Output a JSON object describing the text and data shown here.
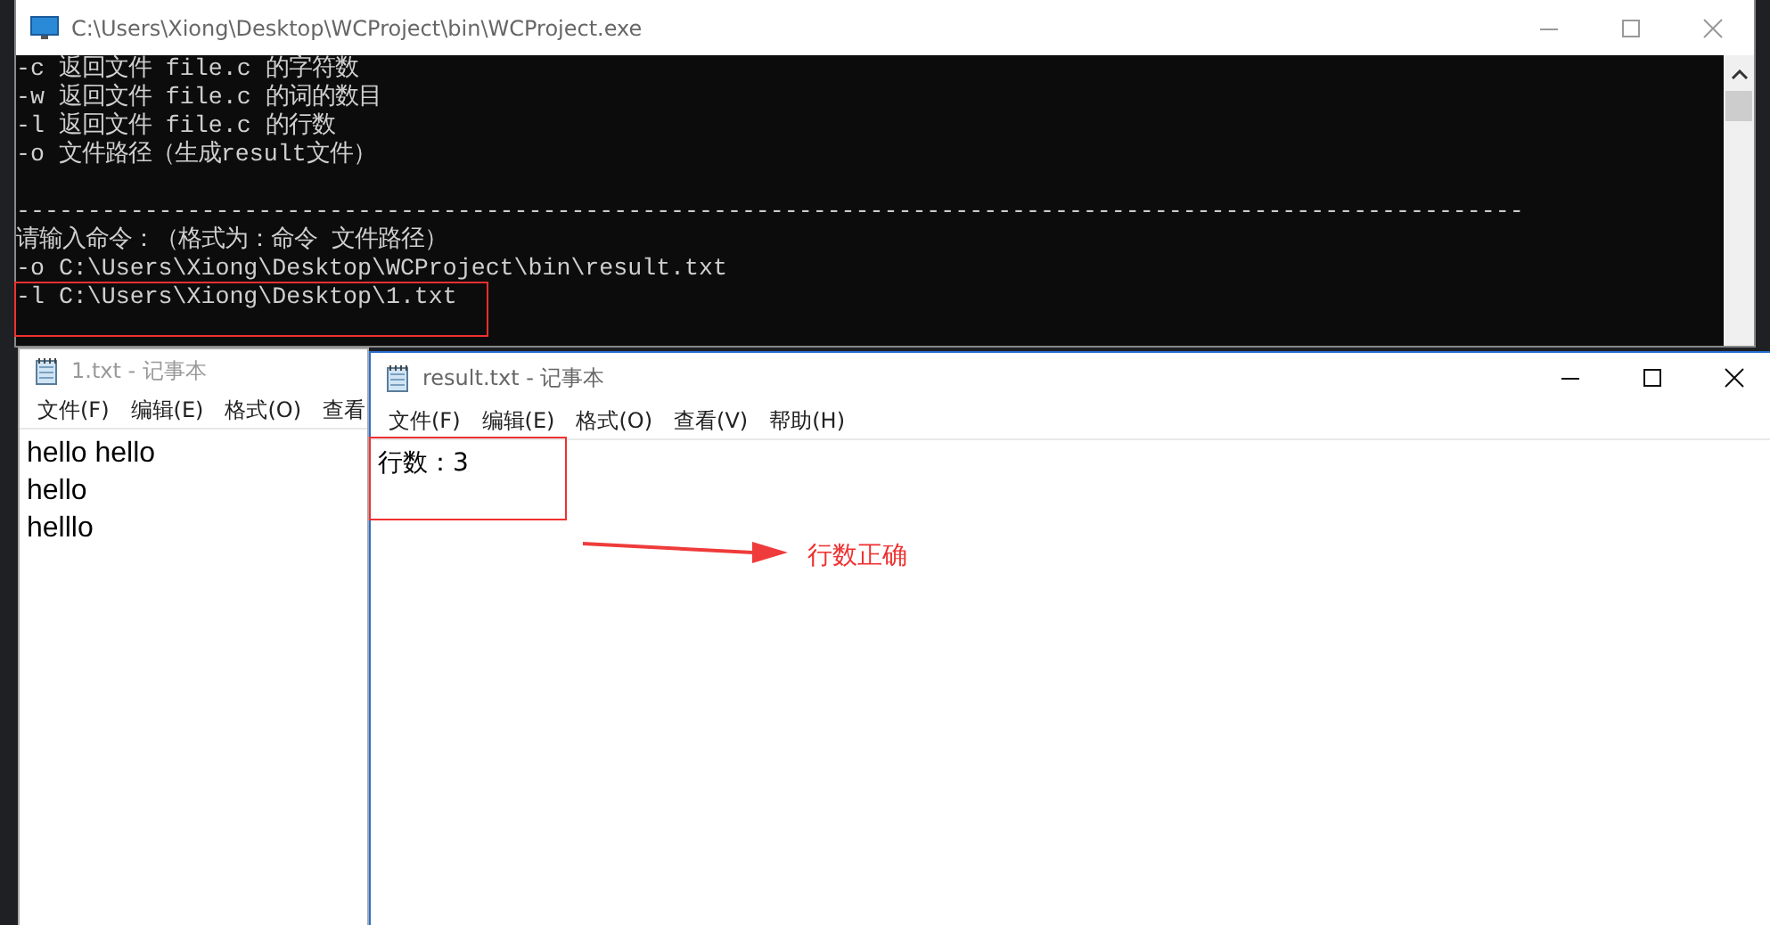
{
  "console": {
    "title": "C:\\Users\\Xiong\\Desktop\\WCProject\\bin\\WCProject.exe",
    "lines": [
      {
        "kind": "text",
        "text": "-c 返回文件 file.c 的字符数"
      },
      {
        "kind": "text",
        "text": "-w 返回文件 file.c 的词的数目"
      },
      {
        "kind": "text",
        "text": "-l 返回文件 file.c 的行数"
      },
      {
        "kind": "text",
        "text": "-o 文件路径（生成result文件）"
      },
      {
        "kind": "separator",
        "text": "----------------------------------------------------------------------------------------------------------"
      },
      {
        "kind": "text",
        "text": "请输入命令：（格式为：命令 文件路径）"
      },
      {
        "kind": "text",
        "text": "-o C:\\Users\\Xiong\\Desktop\\WCProject\\bin\\result.txt"
      },
      {
        "kind": "text",
        "text": "-l C:\\Users\\Xiong\\Desktop\\1.txt"
      }
    ]
  },
  "notepads": [
    {
      "title": "1.txt - 记事本",
      "menu": [
        "文件(F)",
        "编辑(E)",
        "格式(O)",
        "查看"
      ],
      "lines": [
        "hello hello",
        "hello",
        "helllo"
      ]
    },
    {
      "title": "result.txt - 记事本",
      "menu": [
        "文件(F)",
        "编辑(E)",
        "格式(O)",
        "查看(V)",
        "帮助(H)"
      ],
      "lines": [
        "行数：3"
      ]
    }
  ],
  "annotation": {
    "text": "行数正确"
  }
}
